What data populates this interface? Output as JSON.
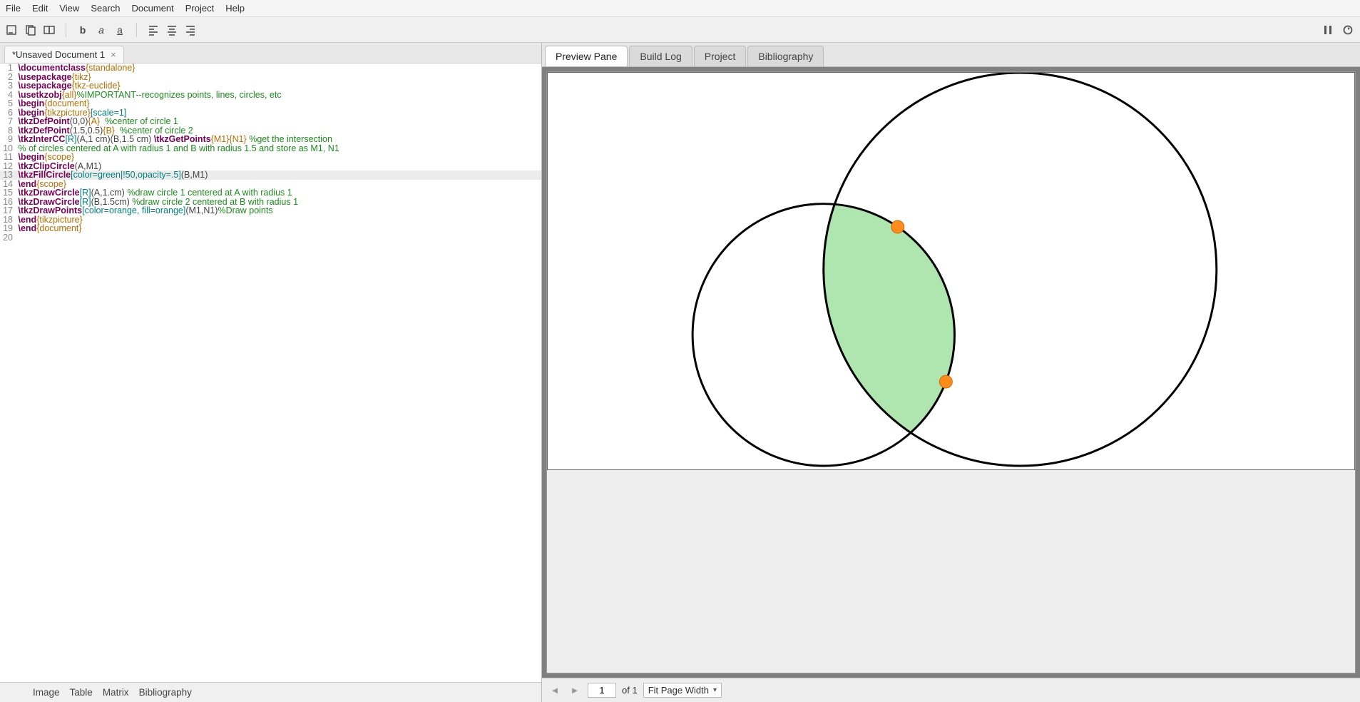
{
  "menubar": [
    "File",
    "Edit",
    "View",
    "Search",
    "Document",
    "Project",
    "Help"
  ],
  "toolbar_icons": {
    "open_term": "open-terminal-icon",
    "copy": "copy-icon",
    "multi": "multi-window-icon",
    "bold": "b",
    "italic": "a",
    "under": "a",
    "align_l": "align-left-icon",
    "align_c": "align-center-icon",
    "align_r": "align-right-icon",
    "pause": "pause-icon",
    "refresh": "refresh-icon"
  },
  "document_tab": {
    "title": "*Unsaved Document 1"
  },
  "code": [
    {
      "n": 1,
      "hl": false,
      "seg": [
        [
          "cmd",
          "\\documentclass"
        ],
        [
          "brace",
          "{standalone}"
        ]
      ]
    },
    {
      "n": 2,
      "hl": false,
      "seg": [
        [
          "cmd",
          "\\usepackage"
        ],
        [
          "brace",
          "{tikz}"
        ]
      ]
    },
    {
      "n": 3,
      "hl": false,
      "seg": [
        [
          "cmd",
          "\\usepackage"
        ],
        [
          "brace",
          "{tkz-euclide}"
        ]
      ]
    },
    {
      "n": 4,
      "hl": false,
      "seg": [
        [
          "cmd",
          "\\usetkzobj"
        ],
        [
          "brace",
          "{all}"
        ],
        [
          "comment",
          "%IMPORTANT--recognizes points, lines, circles, etc"
        ]
      ]
    },
    {
      "n": 5,
      "hl": false,
      "seg": [
        [
          "cmd",
          "\\begin"
        ],
        [
          "brace",
          "{document}"
        ]
      ]
    },
    {
      "n": 6,
      "hl": false,
      "seg": [
        [
          "cmd",
          "\\begin"
        ],
        [
          "brace",
          "{tikzpicture}"
        ],
        [
          "opt",
          "[scale=1]"
        ]
      ]
    },
    {
      "n": 7,
      "hl": false,
      "seg": [
        [
          "cmd",
          "\\tkzDefPoint"
        ],
        [
          "paren",
          "(0,0)"
        ],
        [
          "brace",
          "{A}"
        ],
        [
          "plain",
          "  "
        ],
        [
          "comment",
          "%center of circle 1"
        ]
      ]
    },
    {
      "n": 8,
      "hl": false,
      "seg": [
        [
          "cmd",
          "\\tkzDefPoint"
        ],
        [
          "paren",
          "(1.5,0.5)"
        ],
        [
          "brace",
          "{B}"
        ],
        [
          "plain",
          "  "
        ],
        [
          "comment",
          "%center of circle 2"
        ]
      ]
    },
    {
      "n": 9,
      "hl": false,
      "seg": [
        [
          "cmd",
          "\\tkzInterCC"
        ],
        [
          "opt",
          "[R]"
        ],
        [
          "paren",
          "(A,1 cm)(B,1.5 cm)"
        ],
        [
          "plain",
          " "
        ],
        [
          "cmd",
          "\\tkzGetPoints"
        ],
        [
          "brace",
          "{M1}{N1}"
        ],
        [
          "plain",
          " "
        ],
        [
          "comment",
          "%get the intersection"
        ]
      ]
    },
    {
      "n": 10,
      "hl": false,
      "seg": [
        [
          "comment",
          "% of circles centered at A with radius 1 and B with radius 1.5 and store as M1, N1"
        ]
      ]
    },
    {
      "n": 11,
      "hl": false,
      "seg": [
        [
          "cmd",
          "\\begin"
        ],
        [
          "brace",
          "{scope}"
        ]
      ]
    },
    {
      "n": 12,
      "hl": false,
      "seg": [
        [
          "cmd",
          "\\tkzClipCircle"
        ],
        [
          "paren",
          "(A,M1)"
        ]
      ]
    },
    {
      "n": 13,
      "hl": true,
      "seg": [
        [
          "cmd",
          "\\tkzFillCircle"
        ],
        [
          "opt",
          "[color=green|!50,opacity=.5]"
        ],
        [
          "paren",
          "(B,M1)"
        ]
      ]
    },
    {
      "n": 14,
      "hl": false,
      "seg": [
        [
          "cmd",
          "\\end"
        ],
        [
          "brace",
          "{scope}"
        ]
      ]
    },
    {
      "n": 15,
      "hl": false,
      "seg": [
        [
          "cmd",
          "\\tkzDrawCircle"
        ],
        [
          "opt",
          "[R]"
        ],
        [
          "paren",
          "(A,1.cm)"
        ],
        [
          "plain",
          " "
        ],
        [
          "comment",
          "%draw circle 1 centered at A with radius 1"
        ]
      ]
    },
    {
      "n": 16,
      "hl": false,
      "seg": [
        [
          "cmd",
          "\\tkzDrawCircle"
        ],
        [
          "opt",
          "[R]"
        ],
        [
          "paren",
          "(B,1.5cm)"
        ],
        [
          "plain",
          " "
        ],
        [
          "comment",
          "%draw circle 2 centered at B with radius 1"
        ]
      ]
    },
    {
      "n": 17,
      "hl": false,
      "seg": [
        [
          "cmd",
          "\\tkzDrawPoints"
        ],
        [
          "opt",
          "[color=orange, fill=orange]"
        ],
        [
          "paren",
          "(M1,N1)"
        ],
        [
          "comment",
          "%Draw points"
        ]
      ]
    },
    {
      "n": 18,
      "hl": false,
      "seg": [
        [
          "cmd",
          "\\end"
        ],
        [
          "brace",
          "{tikzpicture}"
        ]
      ]
    },
    {
      "n": 19,
      "hl": false,
      "seg": [
        [
          "cmd",
          "\\end"
        ],
        [
          "brace",
          "{document}"
        ]
      ]
    },
    {
      "n": 20,
      "hl": false,
      "seg": [
        [
          "plain",
          ""
        ]
      ]
    }
  ],
  "bottom_tabs": [
    "Image",
    "Table",
    "Matrix",
    "Bibliography"
  ],
  "preview_tabs": [
    {
      "label": "Preview Pane",
      "active": true
    },
    {
      "label": "Build Log",
      "active": false
    },
    {
      "label": "Project",
      "active": false
    },
    {
      "label": "Bibliography",
      "active": false
    }
  ],
  "preview_footer": {
    "page": "1",
    "of": "of 1",
    "zoom": "Fit Page Width"
  },
  "chart_data": {
    "type": "diagram",
    "description": "Two intersecting circles with lens-shaped intersection shaded light green and two orange intersection points.",
    "circles": [
      {
        "name": "A",
        "cx": 0.0,
        "cy": 0.0,
        "r": 1.0
      },
      {
        "name": "B",
        "cx": 1.5,
        "cy": 0.5,
        "r": 1.5
      }
    ],
    "intersection_points": [
      {
        "name": "M1",
        "x": 0.566,
        "y": 0.824
      },
      {
        "name": "N1",
        "x": 0.934,
        "y": -0.358
      }
    ],
    "fill_region": {
      "color": "#a6e2a6",
      "opacity": 0.5
    },
    "stroke": "#000000",
    "point_fill": "#ff8c1a"
  }
}
